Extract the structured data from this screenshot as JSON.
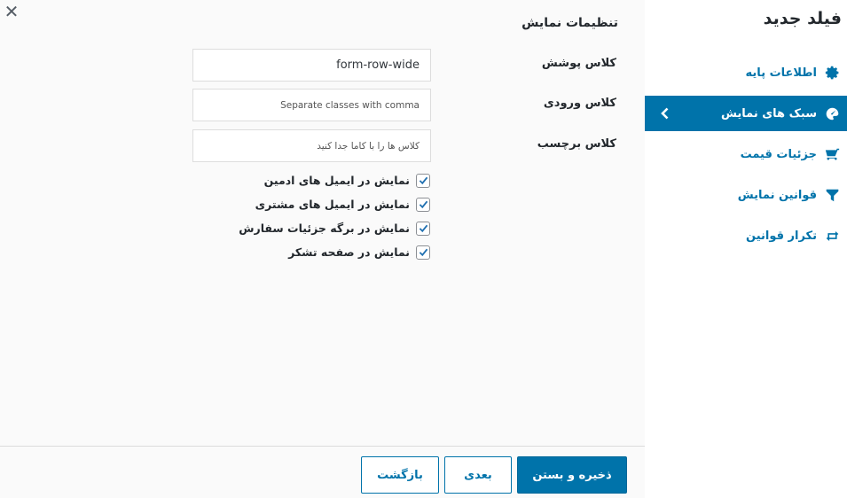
{
  "close": {
    "icon": "close-icon",
    "glyph": "✕"
  },
  "sidebar": {
    "title": "فیلد جدید",
    "items": [
      {
        "label": "اطلاعات پایه",
        "icon": "gear-icon",
        "active": false
      },
      {
        "label": "سبک های نمایش",
        "icon": "palette-icon",
        "active": true
      },
      {
        "label": "جزئیات قیمت",
        "icon": "cart-icon",
        "active": false
      },
      {
        "label": "قوانین نمایش",
        "icon": "filter-icon",
        "active": false
      },
      {
        "label": "تکرار قوانین",
        "icon": "repeat-icon",
        "active": false
      }
    ]
  },
  "main": {
    "section_title": "تنظیمات نمایش",
    "fields": {
      "wrapper_class": {
        "label": "کلاس پوشش",
        "value": "form-row-wide",
        "placeholder": ""
      },
      "input_class": {
        "label": "کلاس ورودی",
        "value": "",
        "placeholder": "Separate classes with comma"
      },
      "label_class": {
        "label": "کلاس برچسب",
        "value": "",
        "placeholder": "کلاس ها را با کاما جدا کنید"
      }
    },
    "checkboxes": [
      {
        "label": "نمایش در ایمیل های ادمین",
        "checked": true
      },
      {
        "label": "نمایش در ایمیل های مشتری",
        "checked": true
      },
      {
        "label": "نمایش در برگه جزئیات سفارش",
        "checked": true
      },
      {
        "label": "نمایش در صفحه تشکر",
        "checked": true
      }
    ]
  },
  "footer": {
    "save_close": "ذخیره و بستن",
    "next": "بعدی",
    "back": "بازگشت"
  },
  "colors": {
    "accent": "#0073aa",
    "text": "#23282d",
    "muted_bg": "#fafafa"
  }
}
